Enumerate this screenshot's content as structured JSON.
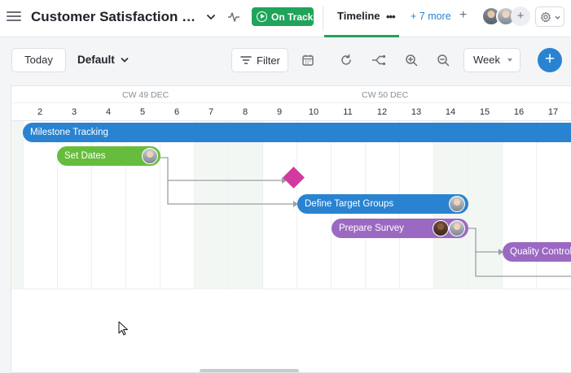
{
  "header": {
    "project_title": "Customer Satisfaction Survey",
    "status": "On Track",
    "active_tab": "Timeline",
    "tab_menu": "•••",
    "more_tabs": "+ 7 more",
    "add_tab": "+",
    "add_member": "+"
  },
  "toolbar": {
    "today_label": "Today",
    "view_label": "Default",
    "filter_label": "Filter",
    "scale_label": "Week",
    "add_label": "+"
  },
  "timeline": {
    "weeks": [
      "CW 49 DEC",
      "CW 50 DEC"
    ],
    "days": [
      "2",
      "3",
      "4",
      "5",
      "6",
      "7",
      "8",
      "9",
      "10",
      "11",
      "12",
      "13",
      "14",
      "15",
      "16",
      "17"
    ],
    "tasks": [
      {
        "name": "Milestone Tracking",
        "color": "#2a83d1"
      },
      {
        "name": "Set Dates",
        "color": "#66bd3d"
      },
      {
        "name": "Define Target Groups",
        "color": "#2a83d1"
      },
      {
        "name": "Prepare Survey",
        "color": "#9b69c1"
      },
      {
        "name": "Quality Control",
        "color": "#9b69c1"
      }
    ],
    "milestone_color": "#d13a9e"
  },
  "colors": {
    "accent": "#2a83d1",
    "status_green": "#1fa45a"
  }
}
